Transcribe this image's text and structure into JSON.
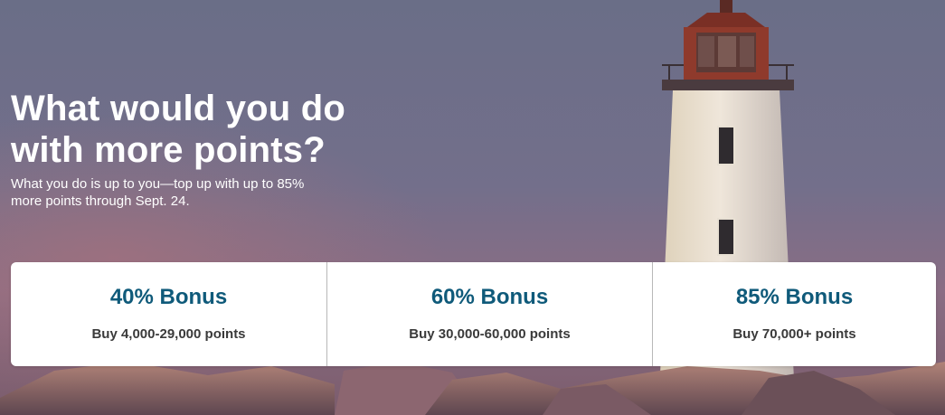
{
  "hero": {
    "headline": "What would you do with more points?",
    "subhead": "What you do is up to you—top up with up to 85% more points through Sept. 24.",
    "image": "lighthouse-on-rocks-photo"
  },
  "offers": [
    {
      "title": "40% Bonus",
      "description": "Buy 4,000-29,000 points"
    },
    {
      "title": "60% Bonus",
      "description": "Buy 30,000-60,000 points"
    },
    {
      "title": "85% Bonus",
      "description": "Buy 70,000+ points"
    }
  ],
  "colors": {
    "offer_title": "#0f5a7a",
    "offer_text": "#3a3a3a",
    "card_background": "#ffffff",
    "headline_text": "#ffffff"
  }
}
